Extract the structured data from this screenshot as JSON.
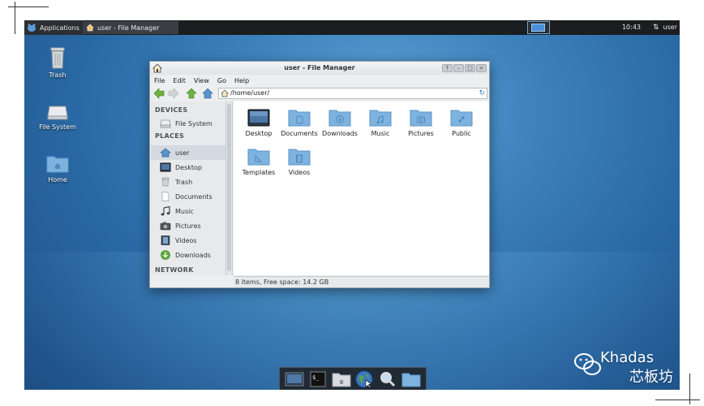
{
  "panel": {
    "applications_label": "Applications",
    "task_label": "user - File Manager",
    "clock": "10:43",
    "user_label": "user"
  },
  "desktop_icons": [
    {
      "label": "Trash"
    },
    {
      "label": "File System"
    },
    {
      "label": "Home"
    }
  ],
  "window": {
    "title": "user - File Manager",
    "menu": [
      "File",
      "Edit",
      "View",
      "Go",
      "Help"
    ],
    "address": "/home/user/",
    "sidebar": {
      "devices_header": "DEVICES",
      "devices": [
        {
          "label": "File System"
        }
      ],
      "places_header": "PLACES",
      "places": [
        {
          "label": "user",
          "selected": true
        },
        {
          "label": "Desktop"
        },
        {
          "label": "Trash"
        },
        {
          "label": "Documents"
        },
        {
          "label": "Music"
        },
        {
          "label": "Pictures"
        },
        {
          "label": "Videos"
        },
        {
          "label": "Downloads"
        }
      ],
      "network_header": "NETWORK"
    },
    "files": [
      {
        "label": "Desktop"
      },
      {
        "label": "Documents"
      },
      {
        "label": "Downloads"
      },
      {
        "label": "Music"
      },
      {
        "label": "Pictures"
      },
      {
        "label": "Public"
      },
      {
        "label": "Templates"
      },
      {
        "label": "Videos"
      }
    ],
    "status": "8 items, Free space: 14.2 GB"
  },
  "watermark": {
    "line1": "Khadas",
    "line2": "芯板坊"
  },
  "colors": {
    "folder": "#7fb3df",
    "folder_dark": "#5a94c8",
    "panel": "#1b1d20",
    "selection": "#d3dae1"
  }
}
